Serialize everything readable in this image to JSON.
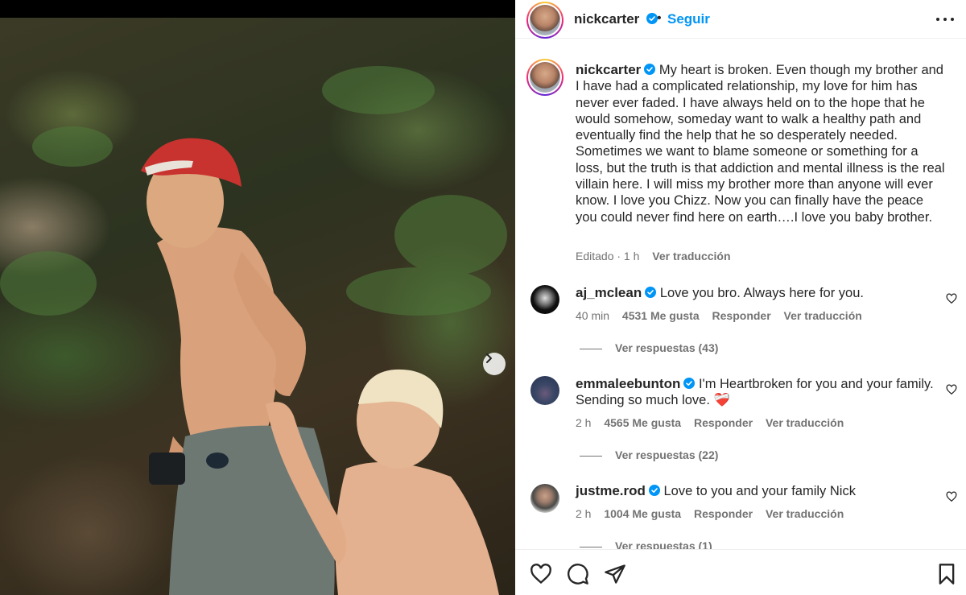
{
  "post": {
    "author": "nickcarter",
    "separator": "•",
    "follow_label": "Seguir",
    "caption": "My heart is broken. Even though my brother and I have had a complicated relationship, my love for him has never ever faded. I have always held on to the hope that he would somehow, someday want to walk a healthy path and eventually find the help that he so desperately needed. Sometimes we want to blame someone or something for a loss, but the truth is that addiction and mental illness is the real villain here. I will miss my brother more than anyone will ever know. I love you Chizz. Now you can finally have the peace you could never find here on earth….I love you baby brother.",
    "edited_label": "Editado · 1 h",
    "translate_label": "Ver traducción"
  },
  "comments": [
    {
      "username": "aj_mclean",
      "text": "Love you bro. Always here for you.",
      "time": "40 min",
      "likes": "4531 Me gusta",
      "reply_label": "Responder",
      "translate_label": "Ver traducción",
      "replies_label": "Ver respuestas (43)"
    },
    {
      "username": "emmaleebunton",
      "text": "I'm Heartbroken for you and your family. Sending so much love. ❤️‍🩹",
      "time": "2 h",
      "likes": "4565 Me gusta",
      "reply_label": "Responder",
      "translate_label": "Ver traducción",
      "replies_label": "Ver respuestas (22)"
    },
    {
      "username": "justme.rod",
      "text": "Love to you and your family Nick",
      "time": "2 h",
      "likes": "1004 Me gusta",
      "reply_label": "Responder",
      "translate_label": "Ver traducción",
      "replies_label": "Ver respuestas (1)"
    }
  ],
  "icons": {
    "verified": "verified-badge-icon",
    "more": "more-options-icon",
    "next": "chevron-right-icon",
    "like": "heart-icon",
    "comment": "comment-bubble-icon",
    "share": "paper-plane-icon",
    "save": "bookmark-icon"
  },
  "colors": {
    "accent": "#0095f6",
    "verified": "#0095f6",
    "text": "#262626",
    "muted": "#737373"
  }
}
